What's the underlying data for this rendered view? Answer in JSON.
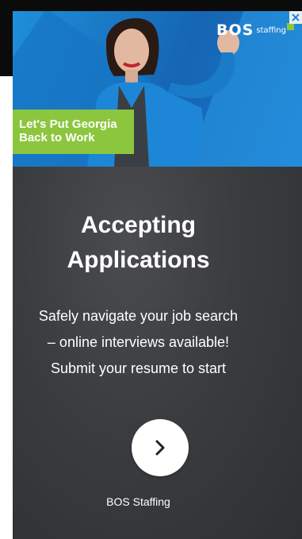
{
  "hero": {
    "banner_line1": "Let's Put Georgia",
    "banner_line2": "Back to Work",
    "logo_text": "BOS",
    "logo_sub": "staffing"
  },
  "main": {
    "headline_line1": "Accepting",
    "headline_line2": "Applications",
    "body_line1": "Safely navigate your job search",
    "body_line2": "– online interviews available!",
    "body_line3": "Submit your resume to start",
    "brand": "BOS Staffing"
  },
  "icons": {
    "cta": "chevron-right-icon",
    "close": "close-icon"
  },
  "colors": {
    "accent_green": "#8cc63f",
    "hero_blue": "#1565b3",
    "panel_dark": "#3a3c40"
  }
}
